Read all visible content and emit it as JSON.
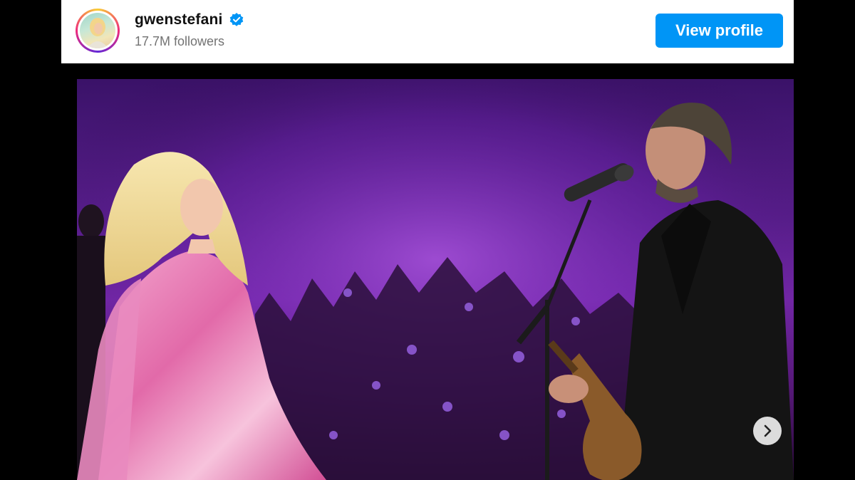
{
  "profile": {
    "username": "gwenstefani",
    "followers": "17.7M followers",
    "verified_icon": "verified-badge-icon",
    "view_profile_label": "View profile"
  },
  "colors": {
    "accent": "#0095f6",
    "verified": "#0095f6",
    "stage_purple": "#5a1f8f",
    "dress_pink": "#e98fc0"
  },
  "post": {
    "next_icon": "chevron-right-icon"
  }
}
